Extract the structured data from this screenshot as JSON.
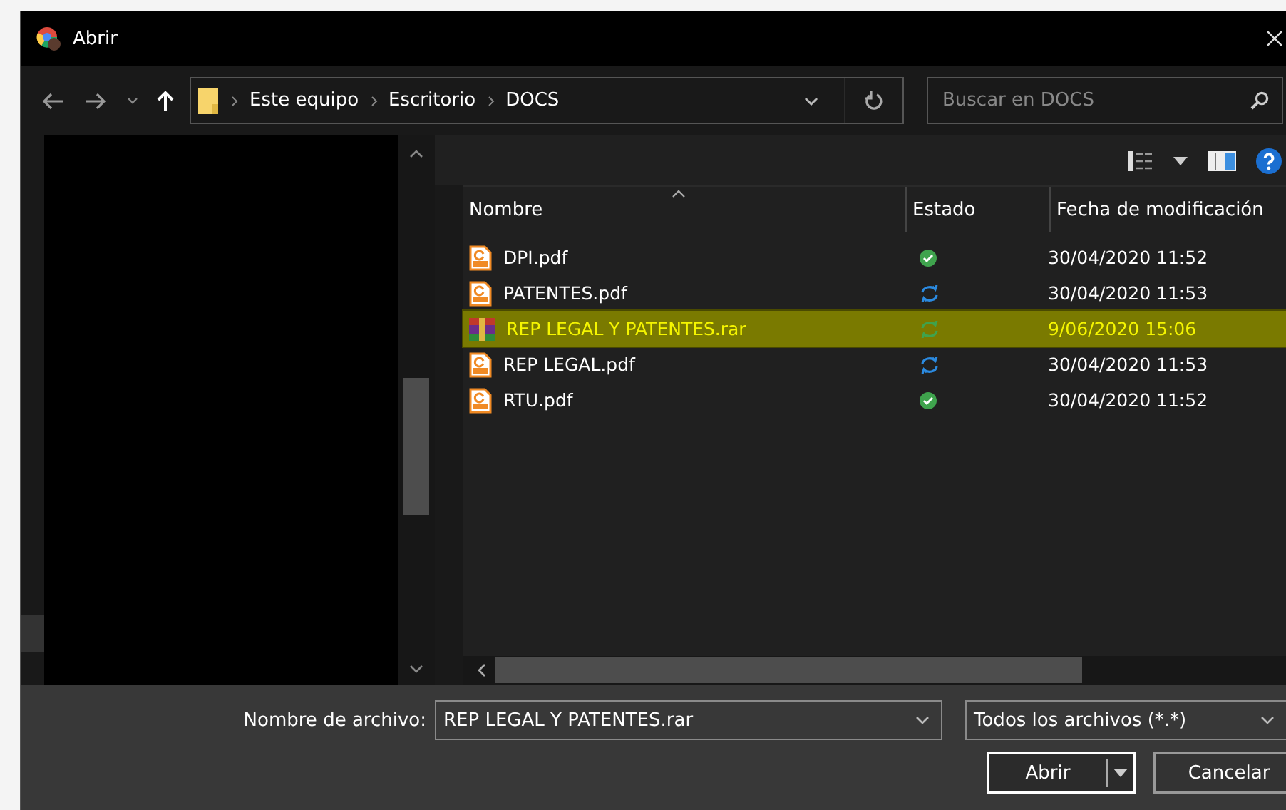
{
  "window": {
    "title": "Abrir"
  },
  "address": {
    "path": [
      "Este equipo",
      "Escritorio",
      "DOCS"
    ]
  },
  "search": {
    "placeholder": "Buscar en DOCS"
  },
  "table": {
    "columns": [
      "Nombre",
      "Estado",
      "Fecha de modificación"
    ],
    "rows": [
      {
        "name": "DPI.pdf",
        "kind": "pdf",
        "status_icon": {
          "kind": "ok",
          "color": "#3fa34d"
        },
        "date": "30/04/2020 11:52",
        "selected": false
      },
      {
        "name": "PATENTES.pdf",
        "kind": "pdf",
        "status_icon": {
          "kind": "sync",
          "color": "#2b8ae0"
        },
        "date": "30/04/2020 11:53",
        "selected": false
      },
      {
        "name": "REP LEGAL Y PATENTES.rar",
        "kind": "rar",
        "status_icon": {
          "kind": "sync",
          "color": "#3fa34d"
        },
        "date": "9/06/2020 15:06",
        "selected": true
      },
      {
        "name": "REP LEGAL.pdf",
        "kind": "pdf",
        "status_icon": {
          "kind": "sync",
          "color": "#2b8ae0"
        },
        "date": "30/04/2020 11:53",
        "selected": false
      },
      {
        "name": "RTU.pdf",
        "kind": "pdf",
        "status_icon": {
          "kind": "ok",
          "color": "#3fa34d"
        },
        "date": "30/04/2020 11:52",
        "selected": false
      }
    ]
  },
  "footer": {
    "filename_label": "Nombre de archivo:",
    "filename": "REP LEGAL Y PATENTES.rar",
    "filter": "Todos los archivos (*.*)",
    "buttons": [
      "Abrir",
      "Cancelar"
    ]
  }
}
